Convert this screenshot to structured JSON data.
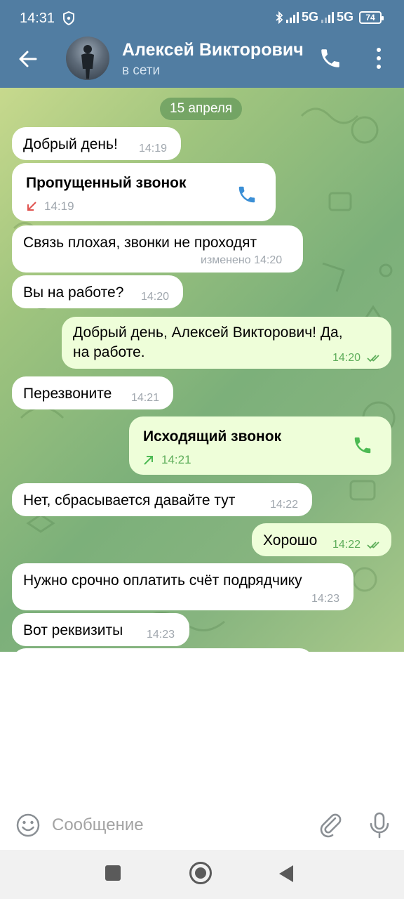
{
  "status_bar": {
    "time": "14:31",
    "network_1": "5G",
    "network_2": "5G",
    "battery": "74"
  },
  "header": {
    "contact_name": "Алексей Викторович",
    "contact_status": "в сети"
  },
  "chat": {
    "date_label": "15 апреля",
    "messages": [
      {
        "text": "Добрый день!",
        "time": "14:19"
      },
      {
        "title": "Пропущенный звонок",
        "time": "14:19"
      },
      {
        "text": "Связь плохая,  звонки не проходят",
        "time": "изменено 14:20"
      },
      {
        "text": "Вы на работе?",
        "time": "14:20"
      },
      {
        "line1": "Добрый день, Алексей Викторович! Да,",
        "line2": "на работе.",
        "time": "14:20"
      },
      {
        "text": "Перезвоните",
        "time": "14:21"
      },
      {
        "title": "Исходящий звонок",
        "time": "14:21"
      },
      {
        "text": "Нет, сбрасывается давайте тут",
        "time": "14:22"
      },
      {
        "text": "Хорошо",
        "time": "14:22"
      },
      {
        "text": "Нужно срочно оплатить счёт подрядчику",
        "time": "14:23"
      },
      {
        "text": "Вот реквизиты",
        "time": "14:23"
      }
    ]
  },
  "input": {
    "placeholder": "Сообщение",
    "value": ""
  },
  "colors": {
    "header": "#517da2",
    "incoming_bubble": "#ffffff",
    "outgoing_bubble": "#eefed9",
    "outgoing_meta": "#5fae5b",
    "missed_call": "#e0534f",
    "outgoing_call": "#4cba53",
    "call_icon_in": "#3b8fd6",
    "call_icon_out": "#4cba53"
  },
  "icons": [
    "shield-icon",
    "back-arrow-icon",
    "phone-icon",
    "more-vert-icon",
    "missed-call-arrow-icon",
    "outgoing-call-arrow-icon",
    "double-check-icon",
    "emoji-icon",
    "attach-icon",
    "mic-icon"
  ]
}
